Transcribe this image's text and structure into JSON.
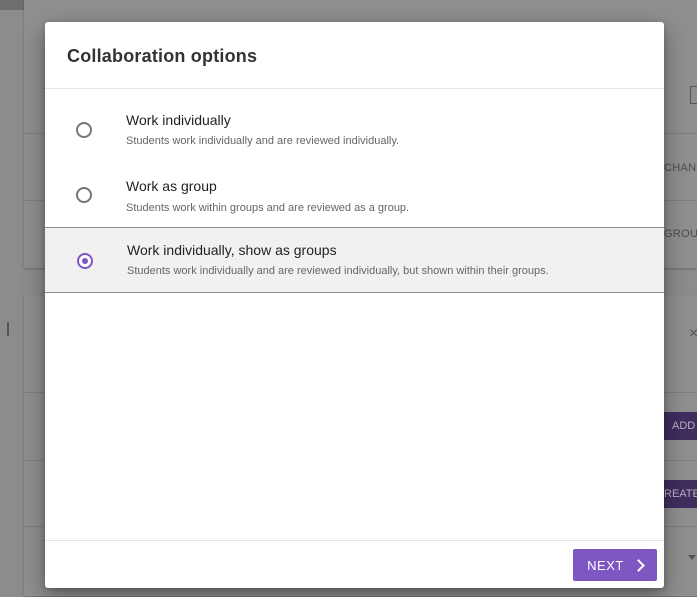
{
  "dialog": {
    "title": "Collaboration options",
    "options": [
      {
        "title": "Work individually",
        "description": "Students work individually and are reviewed individually.",
        "selected": false
      },
      {
        "title": "Work as group",
        "description": "Students work within groups and are reviewed as a group.",
        "selected": false
      },
      {
        "title": "Work individually, show as groups",
        "description": "Students work individually and are reviewed individually, but shown within their groups.",
        "selected": true
      }
    ],
    "next_label": "NEXT"
  },
  "background": {
    "change_label": "CHAN",
    "groups_label": "GROU",
    "add_label": "ADD",
    "create_label": "REATE",
    "close_glyph": "×"
  },
  "colors": {
    "accent": "#7e57c2",
    "selected_bg": "#f1f1f1"
  }
}
